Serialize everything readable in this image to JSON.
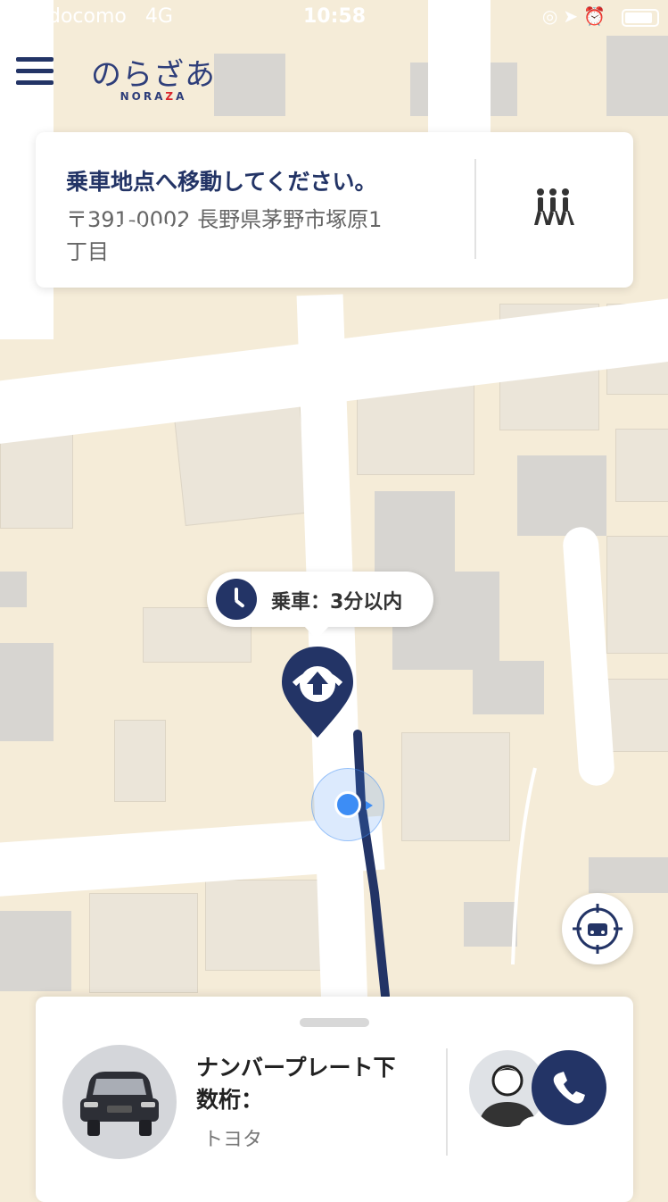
{
  "status_bar": {
    "carrier": "docomo",
    "network": "4G",
    "time": "10:58"
  },
  "app": {
    "logo_jp": "のらざあ",
    "logo_en_a": "NORA",
    "logo_en_b": "Z",
    "logo_en_c": "A"
  },
  "instruction_card": {
    "title": "乗車地点へ移動してください。",
    "address_line1": "〒391-0002 長野県茅野市塚原1",
    "address_line2": "丁目",
    "walk_icon": "walking-people-icon"
  },
  "pickup": {
    "eta_label": "乗車：3分以内"
  },
  "vehicle": {
    "plate_label": "ナンバープレート下",
    "plate_digits_label": "数桁：",
    "maker": "トヨタ"
  },
  "colors": {
    "brand_navy": "#233466",
    "accent_red": "#d9252b",
    "user_dot": "#3d8df5"
  }
}
